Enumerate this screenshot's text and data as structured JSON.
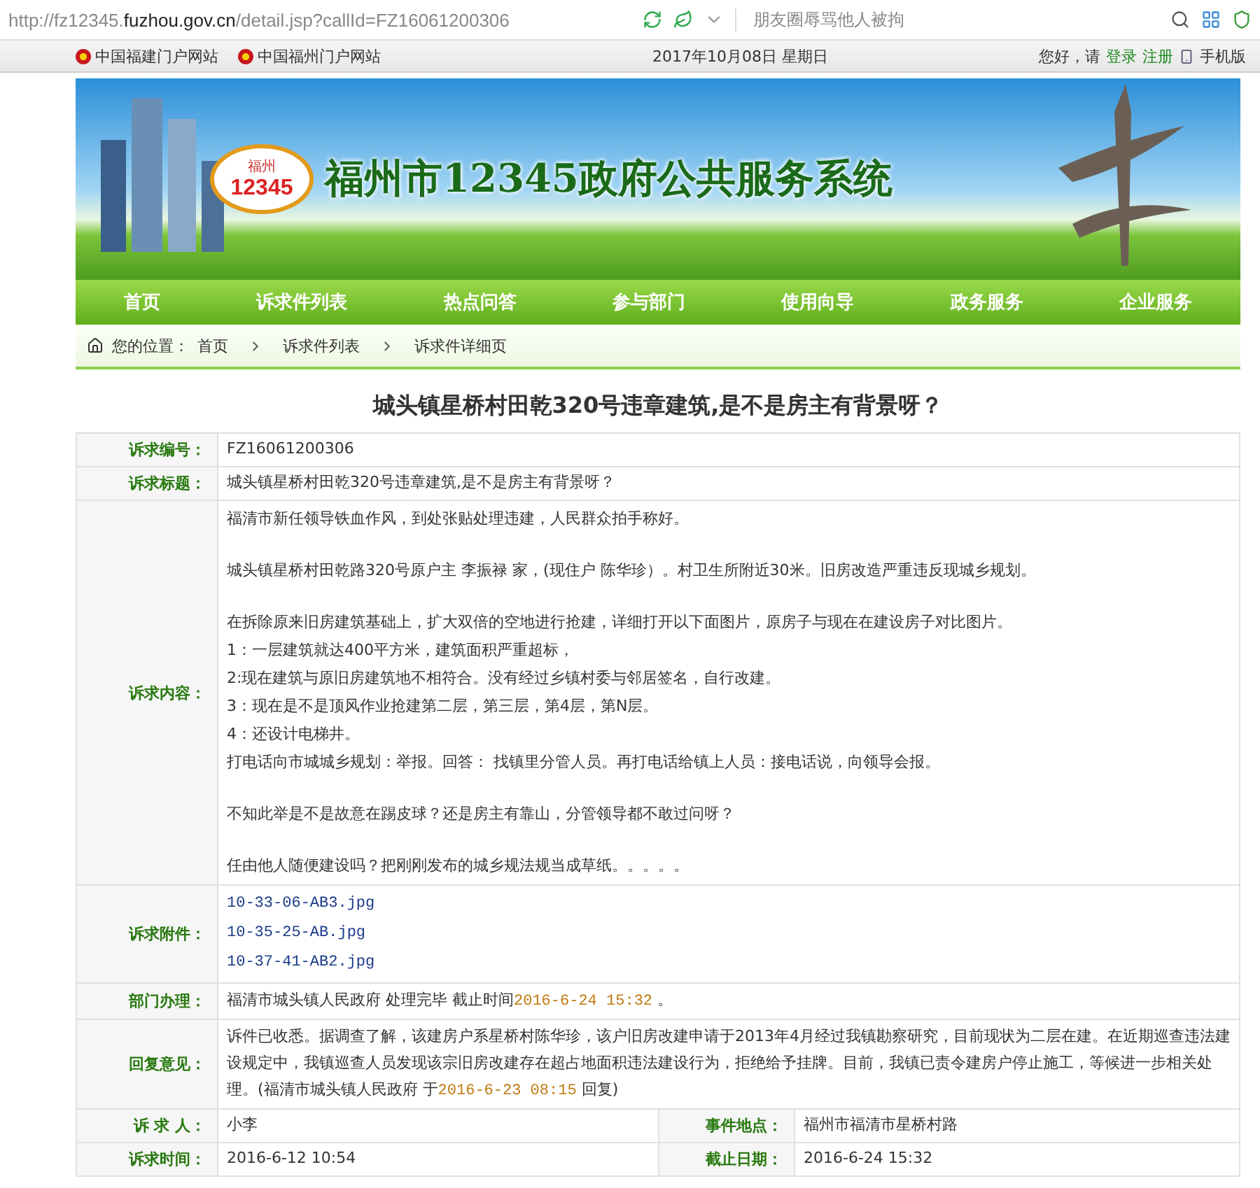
{
  "browser": {
    "url": "http://fz12345.**fuzhou.gov.cn**/detail.jsp?callId=FZ16061200306",
    "search_hint": "朋友圈辱骂他人被拘"
  },
  "top_bar": {
    "portals": [
      "中国福建门户网站",
      "中国福州门户网站"
    ],
    "date": "2017年10月08日  星期日",
    "greeting": "您好，请",
    "login": "登录",
    "register": "注册",
    "mobile": "手机版"
  },
  "banner": {
    "logo_city": "福州",
    "logo_number": "12345",
    "title": "福州市12345政府公共服务系统"
  },
  "nav": [
    "首页",
    "诉求件列表",
    "热点问答",
    "参与部门",
    "使用向导",
    "政务服务",
    "企业服务"
  ],
  "breadcrumb": {
    "label": "您的位置：",
    "items": [
      "首页",
      "诉求件列表",
      "诉求件详细页"
    ]
  },
  "title": "城头镇星桥村田乾320号违章建筑,是不是房主有背景呀？",
  "rows": [
    {
      "kind": "text",
      "label": "诉求编号：",
      "value": "FZ16061200306"
    },
    {
      "kind": "text",
      "label": "诉求标题：",
      "value": "城头镇星桥村田乾320号违章建筑,是不是房主有背景呀？"
    },
    {
      "kind": "paragraphs",
      "label": "诉求内容：",
      "paragraphs": [
        [
          "福清市新任领导铁血作风，到处张贴处理违建，人民群众拍手称好。"
        ],
        [
          "城头镇星桥村田乾路320号原户主 李振禄 家，(现住户 陈华珍）。村卫生所附近30米。旧房改造严重违反现城乡规划。"
        ],
        [
          "在拆除原来旧房建筑基础上，扩大双倍的空地进行抢建，详细打开以下面图片，原房子与现在在建设房子对比图片。",
          "1：一层建筑就达400平方米，建筑面积严重超标，",
          "2:现在建筑与原旧房建筑地不相符合。没有经过乡镇村委与邻居签名，自行改建。",
          "3：现在是不是顶风作业抢建第二层，第三层，第4层，第N层。",
          "4：还设计电梯井。",
          "打电话向市城城乡规划：举报。回答：  找镇里分管人员。再打电话给镇上人员：接电话说，向领导会报。"
        ],
        [
          "不知此举是不是故意在踢皮球？还是房主有靠山，分管领导都不敢过问呀？"
        ],
        [
          "任由他人随便建设吗？把刚刚发布的城乡规法规当成草纸。。。。。"
        ]
      ]
    },
    {
      "kind": "files",
      "label": "诉求附件：",
      "files": [
        "10-33-06-AB3.jpg",
        "10-35-25-AB.jpg",
        "10-37-41-AB2.jpg"
      ]
    },
    {
      "kind": "timed",
      "label": "部门办理：",
      "text": "福清市城头镇人民政府 处理完毕 截止时间",
      "time": "2016-6-24 15:32",
      "tail": " 。"
    },
    {
      "kind": "timed",
      "label": "回复意见：",
      "text": "诉件已收悉。据调查了解，该建房户系星桥村陈华珍，该户旧房改建申请于2013年4月经过我镇勘察研究，目前现状为二层在建。在近期巡查违法建设规定中，我镇巡查人员发现该宗旧房改建存在超占地面积违法建设行为，拒绝给予挂牌。目前，我镇已责令建房户停止施工，等候进一步相关处理。(福清市城头镇人民政府 于",
      "time": "2016-6-23 08:15",
      "tail": " 回复)"
    },
    {
      "kind": "pair",
      "label": "诉 求 人：",
      "value": "小李",
      "label_2": "事件地点：",
      "value_2": "福州市福清市星桥村路"
    },
    {
      "kind": "pair",
      "label": "诉求时间：",
      "value": "2016-6-12 10:54",
      "label_2": "截止日期：",
      "value_2": "2016-6-24 15:32"
    }
  ]
}
